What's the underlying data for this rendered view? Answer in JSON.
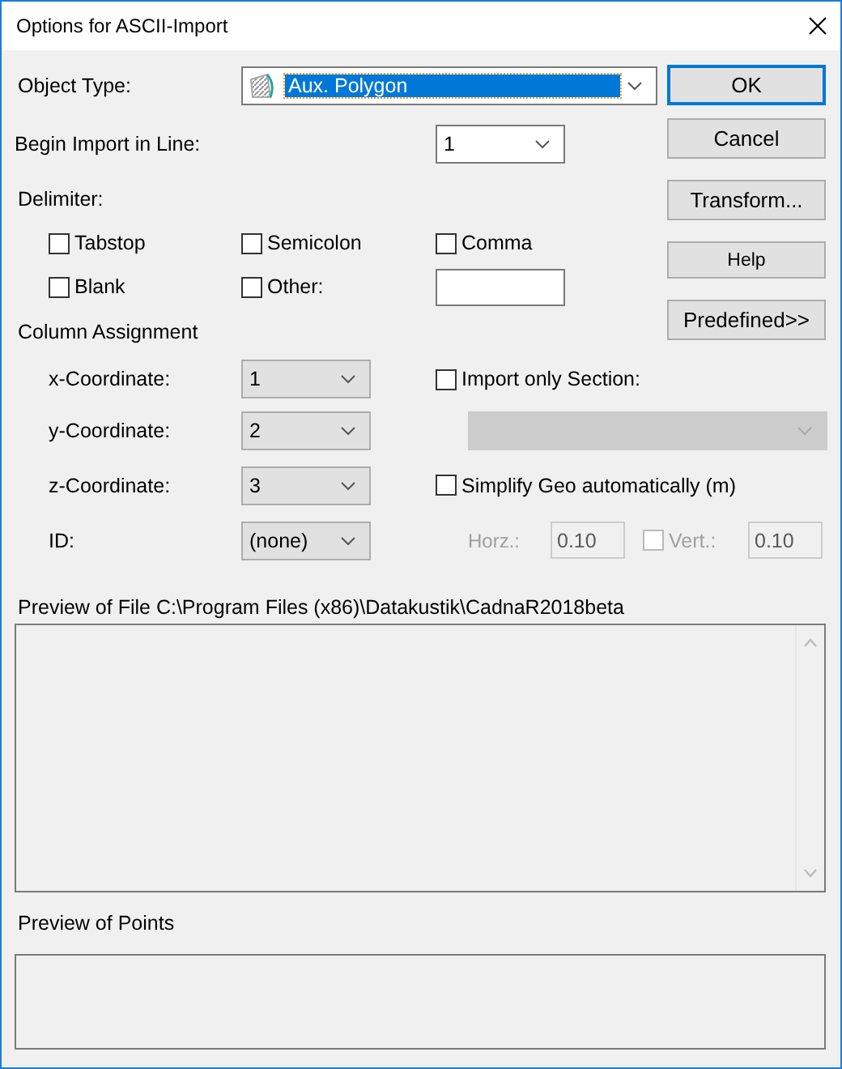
{
  "window": {
    "title": "Options for ASCII-Import"
  },
  "object_type": {
    "label": "Object Type:",
    "value": "Aux. Polygon",
    "highlighted": true
  },
  "begin_line": {
    "label": "Begin Import in Line:",
    "value": "1"
  },
  "delimiter": {
    "label": "Delimiter:",
    "options": [
      {
        "label": "Tabstop",
        "checked": false
      },
      {
        "label": "Semicolon",
        "checked": false
      },
      {
        "label": "Comma",
        "checked": false
      },
      {
        "label": "Blank",
        "checked": false
      },
      {
        "label": "Other:",
        "checked": false
      }
    ]
  },
  "column_assignment": {
    "label": "Column Assignment",
    "rows": [
      {
        "label": "x-Coordinate:",
        "value": "1"
      },
      {
        "label": "y-Coordinate:",
        "value": "2"
      },
      {
        "label": "z-Coordinate:",
        "value": "3"
      },
      {
        "label": "ID:",
        "value": "(none)"
      }
    ]
  },
  "import_section": {
    "label": "Import only Section:",
    "checked": false,
    "combo_disabled": true
  },
  "simplify": {
    "label": "Simplify Geo automatically (m)",
    "checked": false,
    "horz": {
      "label": "Horz.:",
      "value": "0.10",
      "disabled": true
    },
    "vert": {
      "label": "Vert.:",
      "value": "0.10",
      "checked": false,
      "disabled": true
    }
  },
  "preview_file": {
    "label": "Preview of File C:\\Program Files (x86)\\Datakustik\\CadnaR2018beta"
  },
  "preview_points": {
    "label": "Preview of Points"
  },
  "buttons": [
    {
      "label": "OK",
      "default": true
    },
    {
      "label": "Cancel",
      "default": false
    },
    {
      "label": "Transform...",
      "default": false
    },
    {
      "label": "Help",
      "default": false
    },
    {
      "label": "Predefined>>",
      "default": false
    }
  ]
}
